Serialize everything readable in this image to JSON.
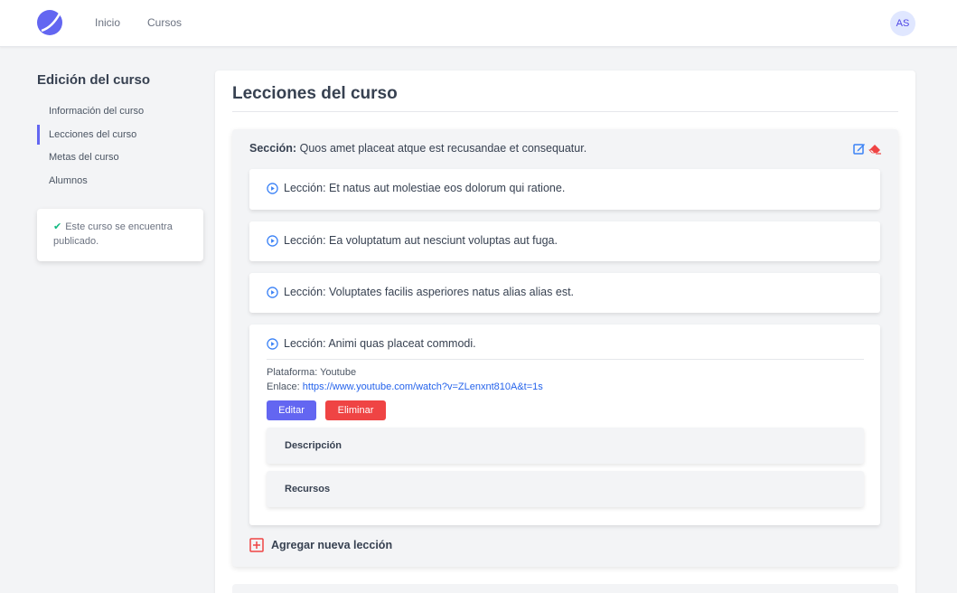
{
  "nav": {
    "links": [
      "Inicio",
      "Cursos"
    ],
    "avatar": "AS",
    "brand_color": "#6366f1"
  },
  "sidebar": {
    "title": "Edición del curso",
    "items": [
      {
        "label": "Información del curso",
        "active": false
      },
      {
        "label": "Lecciones del curso",
        "active": true
      },
      {
        "label": "Metas del curso",
        "active": false
      },
      {
        "label": "Alumnos",
        "active": false
      }
    ],
    "status_card": {
      "icon": "check-icon",
      "text": "Este curso se encuentra publicado."
    }
  },
  "main": {
    "title": "Lecciones del curso",
    "section": {
      "prefix": "Sección:",
      "name": "Quos amet placeat atque est recusandae et consequatur.",
      "icons": [
        "edit-icon",
        "eraser-icon"
      ],
      "lessons": [
        {
          "label": "Lección: Et natus aut molestiae eos dolorum qui ratione."
        },
        {
          "label": "Lección: Ea voluptatum aut nesciunt voluptas aut fuga."
        },
        {
          "label": "Lección: Voluptates facilis asperiores natus alias alias est."
        },
        {
          "label": "Lección: Animi quas placeat commodi."
        }
      ],
      "expanded": {
        "platform_label": "Plataforma:",
        "platform_value": "Youtube",
        "link_label": "Enlace:",
        "link_value": "https://www.youtube.com/watch?v=ZLenxnt810A&t=1s",
        "edit_label": "Editar",
        "delete_label": "Eliminar",
        "description_label": "Descripción",
        "resources_label": "Recursos"
      },
      "add_lesson_label": "Agregar nueva lección"
    }
  },
  "colors": {
    "accent": "#6366f1",
    "danger": "#ef4444",
    "success": "#10b981",
    "link": "#2563eb",
    "play_icon": "#3b82f6"
  }
}
